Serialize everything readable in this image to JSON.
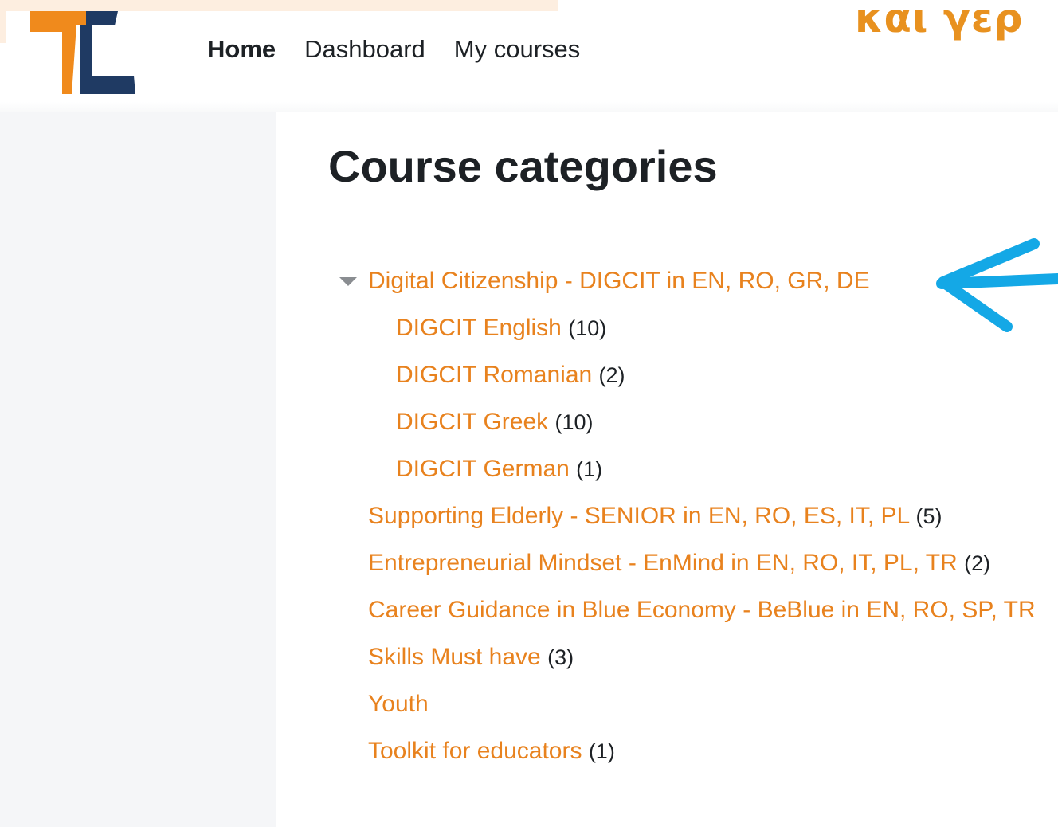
{
  "banner": {
    "text": "και γερ"
  },
  "nav": {
    "items": [
      {
        "label": "Home"
      },
      {
        "label": "Dashboard"
      },
      {
        "label": "My courses"
      }
    ]
  },
  "page": {
    "title": "Course categories"
  },
  "categories": [
    {
      "label": "Digital Citizenship - DIGCIT in EN, RO, GR, DE",
      "count": ""
    },
    {
      "label": "DIGCIT English",
      "count": "(10)"
    },
    {
      "label": "DIGCIT Romanian",
      "count": "(2)"
    },
    {
      "label": "DIGCIT Greek",
      "count": "(10)"
    },
    {
      "label": "DIGCIT German",
      "count": "(1)"
    },
    {
      "label": "Supporting Elderly - SENIOR in EN, RO, ES, IT, PL",
      "count": "(5)"
    },
    {
      "label": "Entrepreneurial Mindset - EnMind in EN, RO, IT, PL, TR",
      "count": "(2)"
    },
    {
      "label": "Career Guidance in Blue Economy - BeBlue in EN, RO, SP, TR",
      "count": ""
    },
    {
      "label": "Skills Must have",
      "count": "(3)"
    },
    {
      "label": "Youth",
      "count": ""
    },
    {
      "label": "Toolkit for educators",
      "count": "(1)"
    }
  ],
  "icons": {
    "logo": "site-logo",
    "toggle": "caret-down-icon",
    "annotation": "blue-arrow-annotation"
  },
  "colors": {
    "link": "#e8821e",
    "banner_text": "#e8911f",
    "logo_orange": "#f08a1c",
    "logo_navy": "#1f3a63",
    "annotation": "#14a8e6"
  }
}
